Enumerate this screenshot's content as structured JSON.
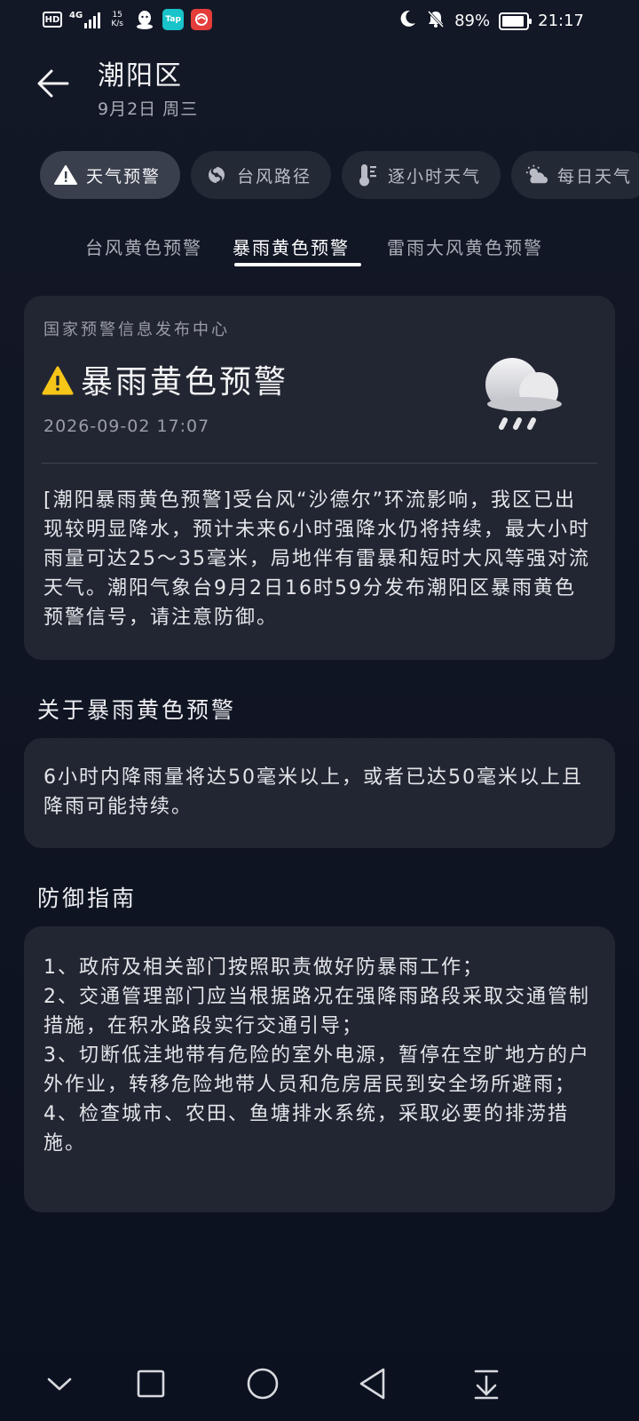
{
  "status_bar": {
    "hd": "HD",
    "network": "4G",
    "speed_value": "15",
    "speed_unit": "K/s",
    "tap_label": "Tap",
    "battery": "89%",
    "time": "21:17"
  },
  "header": {
    "title": "潮阳区",
    "date": "9月2日 周三"
  },
  "chips": [
    {
      "label": "天气预警",
      "icon": "warning-icon",
      "active": true
    },
    {
      "label": "台风路径",
      "icon": "typhoon-icon",
      "active": false
    },
    {
      "label": "逐小时天气",
      "icon": "thermometer-icon",
      "active": false
    },
    {
      "label": "每日天气",
      "icon": "partly-cloudy-icon",
      "active": false
    }
  ],
  "subtabs": [
    {
      "label": "台风黄色预警",
      "active": false
    },
    {
      "label": "暴雨黄色预警",
      "active": true
    },
    {
      "label": "雷雨大风黄色预警",
      "active": false
    }
  ],
  "alert": {
    "source": "国家预警信息发布中心",
    "title": "暴雨黄色预警",
    "time": "2026-09-02 17:07",
    "icon": "rain-cloud-icon",
    "body": "[潮阳暴雨黄色预警]受台风“沙德尔”环流影响，我区已出现较明显降水，预计未来6小时强降水仍将持续，最大小时雨量可达25～35毫米，局地伴有雷暴和短时大风等强对流天气。潮阳气象台9月2日16时59分发布潮阳区暴雨黄色预警信号，请注意防御。"
  },
  "about": {
    "heading": "关于暴雨黄色预警",
    "text": "6小时内降雨量将达50毫米以上，或者已达50毫米以上且降雨可能持续。"
  },
  "guide": {
    "heading": "防御指南",
    "items": [
      "1、政府及相关部门按照职责做好防暴雨工作；",
      "2、交通管理部门应当根据路况在强降雨路段采取交通管制措施，在积水路段实行交通引导；",
      "3、切断低洼地带有危险的室外电源，暂停在空旷地方的户外作业，转移危险地带人员和危房居民到安全场所避雨；",
      "4、检查城市、农田、鱼塘排水系统，采取必要的排涝措施。"
    ]
  },
  "colors": {
    "background": "#131827",
    "card": "#222632",
    "chip": "#242936",
    "chip_active": "#3a3f4d",
    "warning_yellow": "#f5c518"
  }
}
